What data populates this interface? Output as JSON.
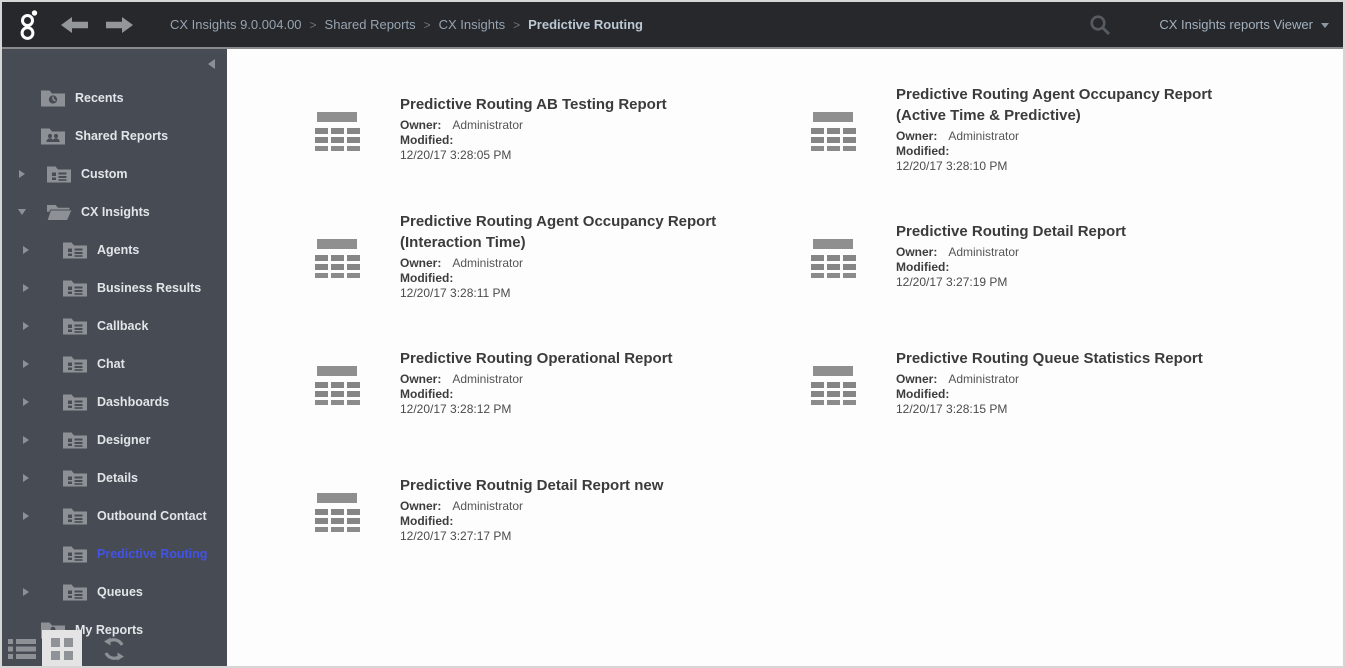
{
  "colors": {
    "accent": "#4253e8",
    "topbar_bg": "#26282b",
    "sidebar_bg": "#474c54"
  },
  "topbar": {
    "breadcrumb": [
      {
        "label": "CX Insights 9.0.004.00",
        "current": false
      },
      {
        "label": "Shared Reports",
        "current": false
      },
      {
        "label": "CX Insights",
        "current": false
      },
      {
        "label": "Predictive Routing",
        "current": true
      }
    ],
    "user_menu": "CX Insights reports Viewer"
  },
  "sidebar": {
    "items": [
      {
        "label": "Recents",
        "level": 1,
        "icon": "recents-folder",
        "arrow": "none",
        "selected": false
      },
      {
        "label": "Shared Reports",
        "level": 1,
        "icon": "shared-folder",
        "arrow": "none",
        "selected": false
      },
      {
        "label": "Custom",
        "level": 2,
        "icon": "report-folder",
        "arrow": "collapsed",
        "selected": false
      },
      {
        "label": "CX Insights",
        "level": 2,
        "icon": "open-folder",
        "arrow": "expanded",
        "selected": false
      },
      {
        "label": "Agents",
        "level": 3,
        "icon": "report-folder",
        "arrow": "collapsed",
        "selected": false
      },
      {
        "label": "Business Results",
        "level": 3,
        "icon": "report-folder",
        "arrow": "collapsed",
        "selected": false
      },
      {
        "label": "Callback",
        "level": 3,
        "icon": "report-folder",
        "arrow": "collapsed",
        "selected": false
      },
      {
        "label": "Chat",
        "level": 3,
        "icon": "report-folder",
        "arrow": "collapsed",
        "selected": false
      },
      {
        "label": "Dashboards",
        "level": 3,
        "icon": "report-folder",
        "arrow": "collapsed",
        "selected": false
      },
      {
        "label": "Designer",
        "level": 3,
        "icon": "report-folder",
        "arrow": "collapsed",
        "selected": false
      },
      {
        "label": "Details",
        "level": 3,
        "icon": "report-folder",
        "arrow": "collapsed",
        "selected": false
      },
      {
        "label": "Outbound Contact",
        "level": 3,
        "icon": "report-folder",
        "arrow": "collapsed",
        "selected": false
      },
      {
        "label": "Predictive Routing",
        "level": 3,
        "icon": "report-folder",
        "arrow": "none",
        "selected": true
      },
      {
        "label": "Queues",
        "level": 3,
        "icon": "report-folder",
        "arrow": "collapsed",
        "selected": false
      },
      {
        "label": "My Reports",
        "level": 1,
        "icon": "my-folder",
        "arrow": "none",
        "selected": false
      }
    ],
    "view_toolbar": {
      "list_view": "list-view",
      "grid_view": "grid-view",
      "refresh": "refresh",
      "active_view": "grid-view"
    }
  },
  "labels": {
    "owner": "Owner:",
    "modified": "Modified:"
  },
  "reports": [
    {
      "title": "Predictive Routing AB Testing Report",
      "owner": "Administrator",
      "modified": "12/20/17 3:28:05 PM"
    },
    {
      "title": "Predictive Routing Agent Occupancy Report (Active Time & Predictive)",
      "owner": "Administrator",
      "modified": "12/20/17 3:28:10 PM"
    },
    {
      "title": "Predictive Routing Agent Occupancy Report (Interaction Time)",
      "owner": "Administrator",
      "modified": "12/20/17 3:28:11 PM"
    },
    {
      "title": "Predictive Routing Detail Report",
      "owner": "Administrator",
      "modified": "12/20/17 3:27:19 PM"
    },
    {
      "title": "Predictive Routing Operational Report",
      "owner": "Administrator",
      "modified": "12/20/17 3:28:12 PM"
    },
    {
      "title": "Predictive Routing Queue Statistics Report",
      "owner": "Administrator",
      "modified": "12/20/17 3:28:15 PM"
    },
    {
      "title": "Predictive Routnig Detail Report new",
      "owner": "Administrator",
      "modified": "12/20/17 3:27:17 PM"
    }
  ]
}
